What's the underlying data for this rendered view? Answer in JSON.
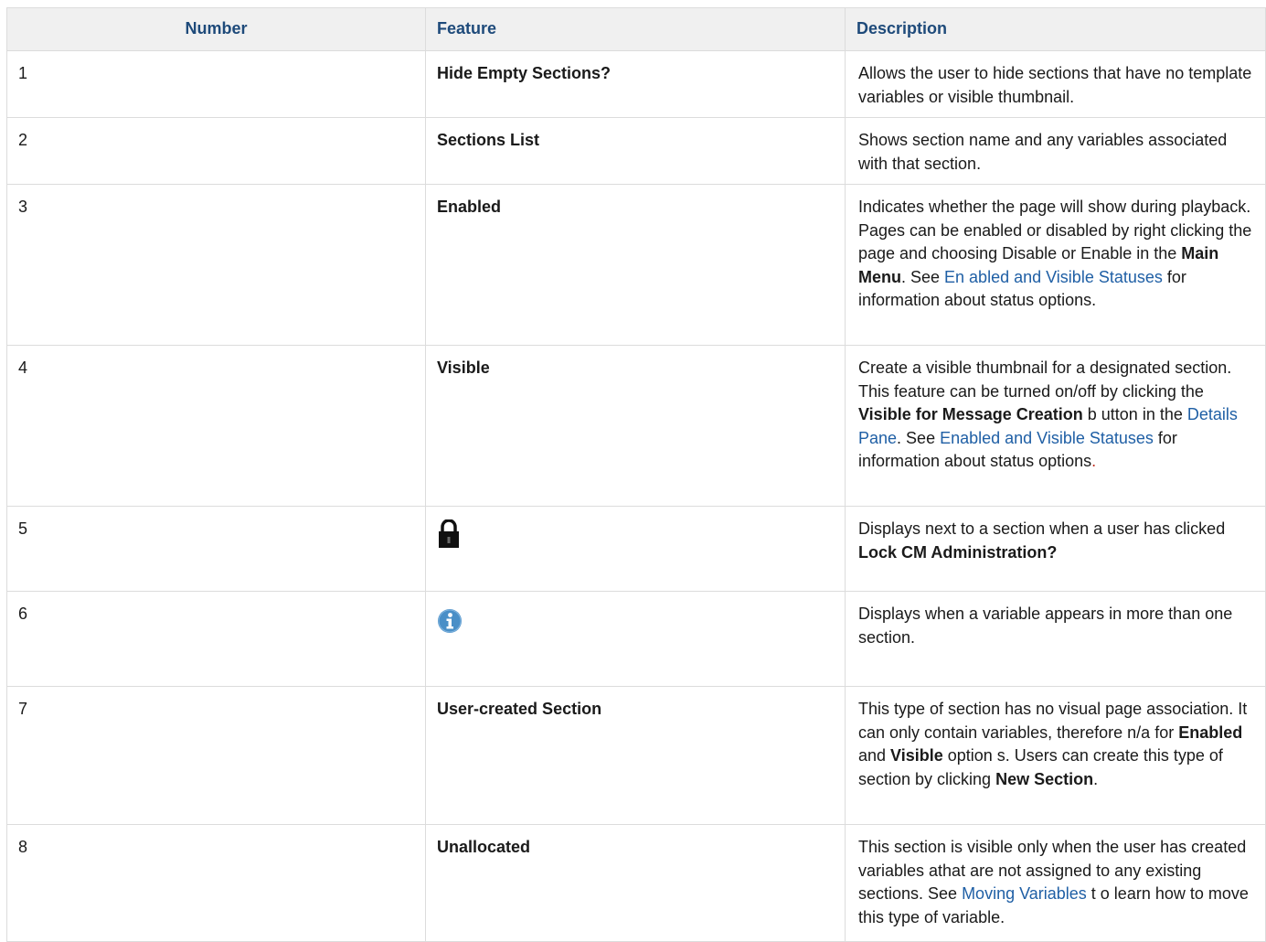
{
  "headers": {
    "number": "Number",
    "feature": "Feature",
    "description": "Description"
  },
  "rows": [
    {
      "number": "1",
      "feature": "Hide Empty Sections?",
      "description": {
        "t1": "Allows the user to hide sections that have no template variables or visible thumbnail."
      }
    },
    {
      "number": "2",
      "feature": "Sections List",
      "description": {
        "t1": "Shows section name and any variables associated with that section."
      }
    },
    {
      "number": "3",
      "feature": "Enabled",
      "description": {
        "t1": "Indicates whether the page will show during playback. Pages can be enabled or disabled by right clicking the page and choosing Disable or Enable in the ",
        "b1": "Main Menu",
        "t2": ". See ",
        "link1": "En abled and Visible Statuses",
        "t3": " for information about status options."
      }
    },
    {
      "number": "4",
      "feature": "Visible",
      "description": {
        "t1": "Create a visible thumbnail for a designated section. This feature can be turned on/off by clicking the ",
        "b1": "Visible for Message Creation",
        "t2": " b utton in the ",
        "link1": "Details Pane",
        "t3": ". See ",
        "link2": "Enabled and Visible Statuses",
        "t4": " for information about status options",
        "t5": "."
      }
    },
    {
      "number": "5",
      "feature_icon": "lock-icon",
      "description": {
        "t1": "Displays next to a section when a user has clicked ",
        "b1": "Lock CM Administration?"
      }
    },
    {
      "number": "6",
      "feature_icon": "info-icon",
      "description": {
        "t1": "Displays when a variable appears in more than one section."
      }
    },
    {
      "number": "7",
      "feature": "User-created Section",
      "description": {
        "t1": "This type of section has no visual page association. It can only contain variables, therefore n/a for ",
        "b1": "Enabled",
        "t2": " and ",
        "b2": "Visible",
        "t3": " option s. Users can create this type of section by clicking ",
        "b3": "New Section",
        "t4": "."
      }
    },
    {
      "number": "8",
      "feature": "Unallocated",
      "description": {
        "t1": "This section is visible only when the user has created variables athat are not assigned to any existing sections. See ",
        "link1": "Moving Variables",
        "t2": " t o learn how to move this type of variable."
      }
    }
  ],
  "colors": {
    "header_text": "#1e4a7a",
    "header_bg": "#f0f0f0",
    "link": "#1f5fa5",
    "info_icon": "#4a8fc7"
  }
}
